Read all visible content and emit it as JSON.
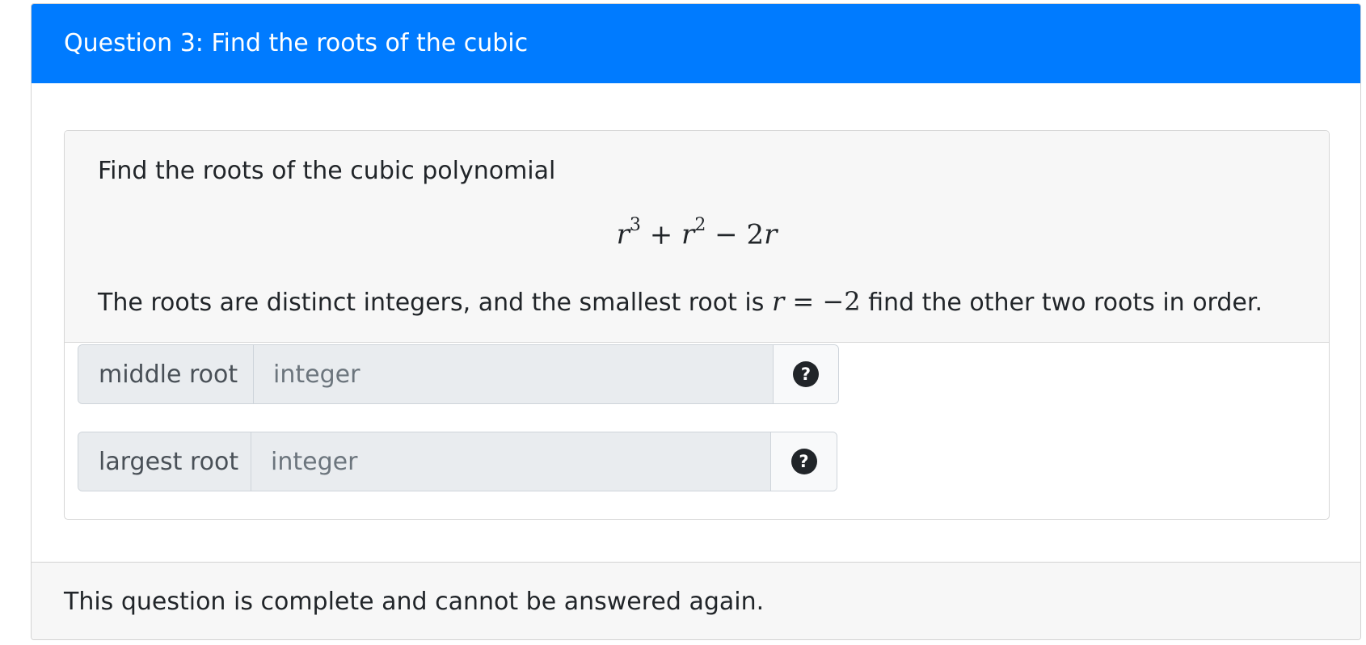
{
  "header": {
    "title": "Question 3: Find the roots of the cubic"
  },
  "question": {
    "intro": "Find the roots of the cubic polynomial",
    "equation": {
      "variable": "r",
      "exp1": "3",
      "plus": "+",
      "exp2": "2",
      "minus": "−",
      "coeff": "2"
    },
    "statement_before": "The roots are distinct integers, and the smallest root is ",
    "statement_math_var": "r",
    "statement_math_rest": " = −2",
    "statement_after": " find the other two roots in order."
  },
  "inputs": [
    {
      "label": "middle root",
      "value": "",
      "placeholder": "integer",
      "help_icon": "question-circle-icon"
    },
    {
      "label": "largest root",
      "value": "",
      "placeholder": "integer",
      "help_icon": "question-circle-icon"
    }
  ],
  "help_glyph": "?",
  "footer": {
    "status": "This question is complete and cannot be answered again."
  }
}
